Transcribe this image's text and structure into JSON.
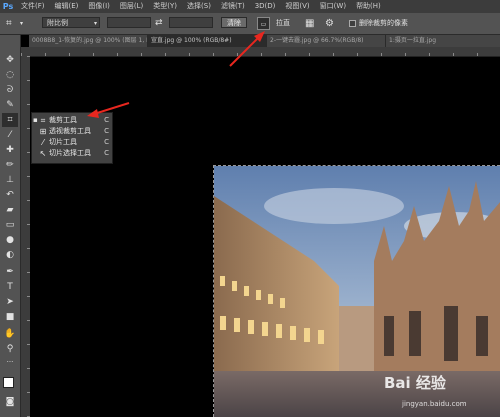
{
  "colors": {
    "accent_arrow": "#e8271f",
    "logo_blue": "#5aa8ff"
  },
  "app": {
    "logo": "Ps",
    "menu": [
      "文件(F)",
      "编辑(E)",
      "图像(I)",
      "图层(L)",
      "类型(Y)",
      "选择(S)",
      "滤镜(T)",
      "3D(D)",
      "视图(V)",
      "窗口(W)",
      "帮助(H)"
    ]
  },
  "options": {
    "ratio_value": "附比例",
    "swap_icon": "swap-arrows-icon",
    "clear_label": "清除",
    "straighten_label": "拉直",
    "delete_cropped_label": "删除裁剪的像素"
  },
  "tabs": [
    "0008B8_1-恢复的.jpg @ 100% (图层 1, RGB/8*)",
    "宣直.jpg @ 100% (RGB/8#)",
    "2-一键去霾.jpg @ 66.7%(RGB/8)",
    "1:摄页一拉直.jpg"
  ],
  "flyout": {
    "items": [
      {
        "label": "裁剪工具",
        "key": "C",
        "icon": "crop-icon",
        "active": true
      },
      {
        "label": "透视裁剪工具",
        "key": "C",
        "icon": "perspective-crop-icon",
        "active": false
      },
      {
        "label": "切片工具",
        "key": "C",
        "icon": "slice-icon",
        "active": false
      },
      {
        "label": "切片选择工具",
        "key": "C",
        "icon": "slice-select-icon",
        "active": false
      }
    ]
  },
  "watermark": {
    "text": "Bai 经验",
    "url": "jingyan.baidu.com"
  }
}
